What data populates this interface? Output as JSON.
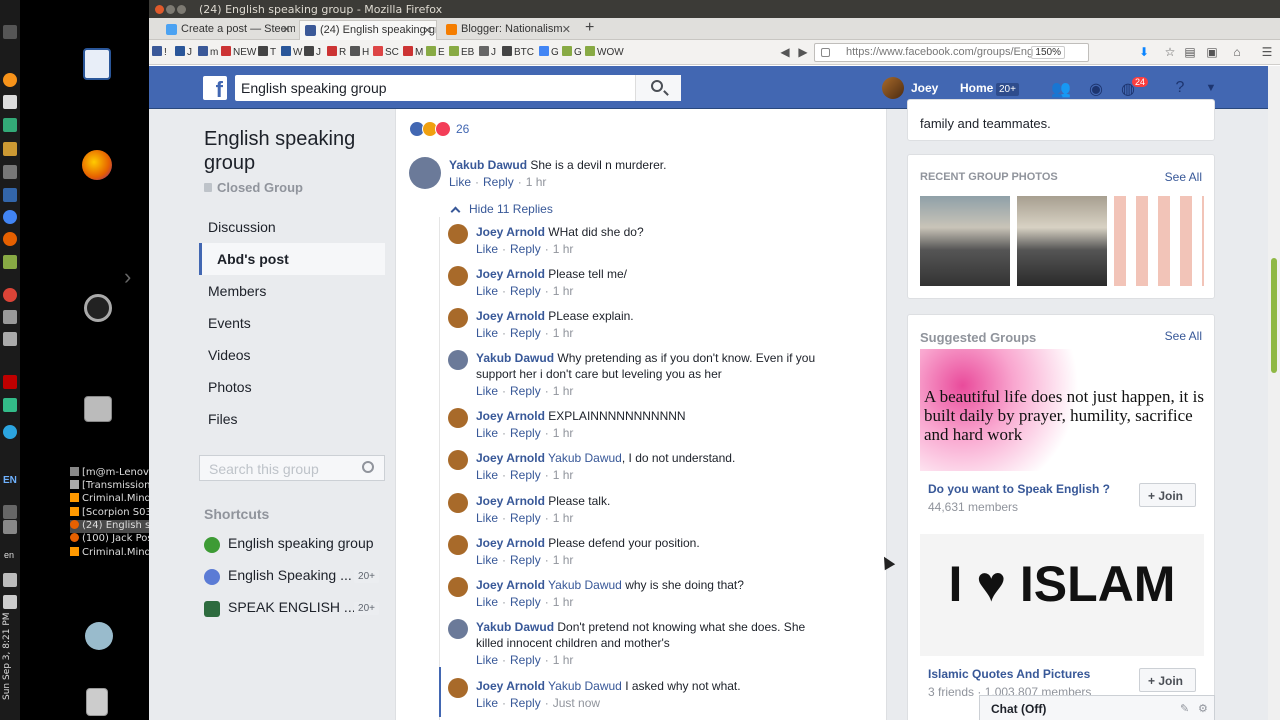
{
  "window": {
    "title": "(24) English speaking group - Mozilla Firefox"
  },
  "tabs": [
    {
      "label": "Create a post — Steemit",
      "fav_color": "#4ba2f2"
    },
    {
      "label": "(24) English speaking gr",
      "fav_color": "#3b5998"
    },
    {
      "label": "Blogger: Nationalism",
      "fav_color": "#f57d00"
    }
  ],
  "bookmarks": [
    "!",
    "J",
    "m",
    "NEW",
    "T",
    "W",
    "J",
    "R",
    "H",
    "SC",
    "M",
    "E",
    "EB",
    "J",
    "BTC",
    "G",
    "G",
    "WOW"
  ],
  "urlbar": {
    "url": "https://www.facebook.com/groups/Eng",
    "zoom": "150%"
  },
  "desktop": {
    "taskbar": [
      {
        "label": "[m@m-Lenovo-...",
        "icon_color": "#888"
      },
      {
        "label": "[Transmission]",
        "icon_color": "#aaa"
      },
      {
        "label": "Criminal.Minds...",
        "icon_color": "#f90"
      },
      {
        "label": "[Scorpion S03 ...",
        "icon_color": "#f90"
      },
      {
        "label": "(24) English sp...",
        "icon_color": "#e66000"
      },
      {
        "label": "(100) Jack Pos...",
        "icon_color": "#e66000"
      },
      {
        "label": "Criminal.Minds...",
        "icon_color": "#f90"
      }
    ],
    "lang_code": "EN",
    "lang_short": "en",
    "clock": "Sun Sep 3, 8:21 PM"
  },
  "fb": {
    "search_value": "English speaking group",
    "user": "Joey",
    "home_label": "Home",
    "home_count": "20+",
    "notif_count": "24"
  },
  "group": {
    "name": "English speaking group",
    "privacy": "Closed Group",
    "nav": [
      "Discussion",
      "Abd's post",
      "Members",
      "Events",
      "Videos",
      "Photos",
      "Files"
    ],
    "search_placeholder": "Search this group",
    "shortcuts_title": "Shortcuts",
    "shortcuts": [
      {
        "label": "English speaking group",
        "count": "",
        "color": "#3d9b35"
      },
      {
        "label": "English Speaking ...",
        "count": "20+",
        "color": "#5b7bd5"
      },
      {
        "label": "SPEAK ENGLISH ...",
        "count": "20+",
        "color": "#2d6b3e"
      }
    ]
  },
  "post": {
    "reaction_count": "26"
  },
  "comments": {
    "hide_replies": "Hide 11 Replies",
    "like": "Like",
    "reply": "Reply",
    "items": [
      {
        "author": "Yakub Dawud",
        "tag": "",
        "text": "She is a devil n murderer.",
        "time": "1 hr",
        "level": 0
      },
      {
        "author": "Joey Arnold",
        "tag": "",
        "text": "WHat did she do?",
        "time": "1 hr",
        "level": 1
      },
      {
        "author": "Joey Arnold",
        "tag": "",
        "text": "Please tell me/",
        "time": "1 hr",
        "level": 1
      },
      {
        "author": "Joey Arnold",
        "tag": "",
        "text": "PLease explain.",
        "time": "1 hr",
        "level": 1
      },
      {
        "author": "Yakub Dawud",
        "tag": "",
        "text": "Why pretending as if you don't know. Even if you support her i don't care but leveling you as her",
        "time": "1 hr",
        "level": 1
      },
      {
        "author": "Joey Arnold",
        "tag": "",
        "text": "EXPLAINNNNNNNNNNN",
        "time": "1 hr",
        "level": 1
      },
      {
        "author": "Joey Arnold",
        "tag": "Yakub Dawud",
        "text": ", I do not understand.",
        "time": "1 hr",
        "level": 1
      },
      {
        "author": "Joey Arnold",
        "tag": "",
        "text": "Please talk.",
        "time": "1 hr",
        "level": 1
      },
      {
        "author": "Joey Arnold",
        "tag": "",
        "text": "Please defend your position.",
        "time": "1 hr",
        "level": 1
      },
      {
        "author": "Joey Arnold",
        "tag": "Yakub Dawud",
        "text": " why is she doing that?",
        "time": "1 hr",
        "level": 1
      },
      {
        "author": "Yakub Dawud",
        "tag": "",
        "text": "Don't pretend not knowing what she does. She killed innocent children and mother's",
        "time": "1 hr",
        "level": 1
      },
      {
        "author": "Joey Arnold",
        "tag": "Yakub Dawud",
        "text": " I asked why not what.",
        "time": "Just now",
        "level": 1
      }
    ]
  },
  "right": {
    "prev_text": "family and teammates.",
    "photos_title": "RECENT GROUP PHOTOS",
    "see_all": "See All",
    "suggested_title": "Suggested Groups",
    "join_label": "Join",
    "suggested": [
      {
        "name": "Do you want to Speak English ?",
        "meta": "44,631 members",
        "image_text": "A beautiful life does not just happen, it is built daily by prayer, humility, sacrifice and hard work"
      },
      {
        "name": "Islamic Quotes And Pictures",
        "meta": "3 friends · 1,003,807 members",
        "image_text": "I ♥ ISLAM"
      }
    ]
  },
  "chat": {
    "label": "Chat (Off)"
  }
}
